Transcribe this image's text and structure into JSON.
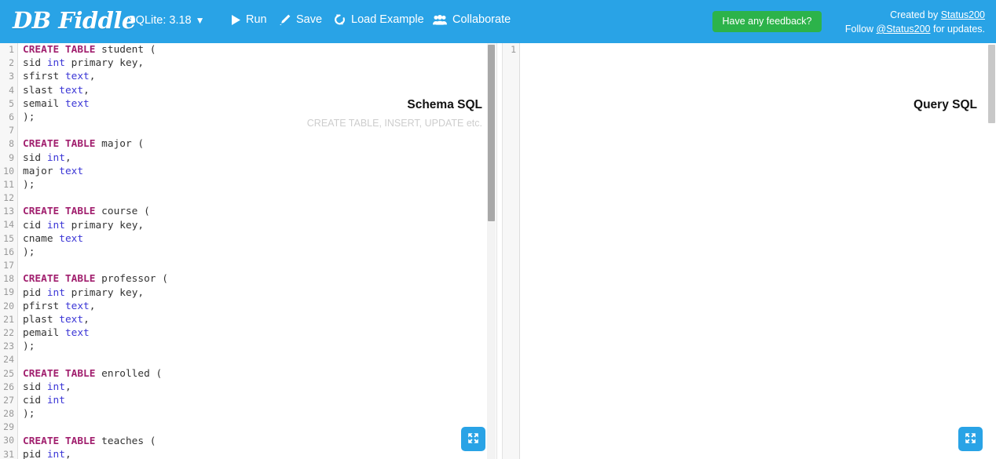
{
  "header": {
    "logo": "DB Fiddle",
    "db_version_label": "SQLite: 3.18",
    "db_caret": "▼",
    "buttons": [
      {
        "id": "run",
        "label": "Run",
        "icon": "play-icon"
      },
      {
        "id": "save",
        "label": "Save",
        "icon": "pencil-icon"
      },
      {
        "id": "load",
        "label": "Load Example",
        "icon": "refresh-icon"
      },
      {
        "id": "collaborate",
        "label": "Collaborate",
        "icon": "users-icon"
      }
    ],
    "feedback_label": "Have any feedback?",
    "credits_line1_prefix": "Created by ",
    "credits_line1_link": "Status200",
    "credits_line2_prefix": "Follow ",
    "credits_line2_link": "@Status200",
    "credits_line2_suffix": " for updates.",
    "colors": {
      "header_bg": "#29a3e6",
      "feedback_bg": "#2cb34a",
      "accent": "#29a3e6"
    }
  },
  "schema_panel": {
    "title": "Schema SQL",
    "hint": "CREATE TABLE, INSERT, UPDATE etc.",
    "expand_icon": "expand-arrows-icon",
    "first_line_number": 1,
    "line_count": 31,
    "lines": [
      [
        [
          "kw",
          "CREATE TABLE"
        ],
        [
          "ident",
          " student ("
        ]
      ],
      [
        [
          "ident",
          "sid "
        ],
        [
          "type",
          "int"
        ],
        [
          "ident",
          " primary key,"
        ]
      ],
      [
        [
          "ident",
          "sfirst "
        ],
        [
          "type",
          "text"
        ],
        [
          "ident",
          ","
        ]
      ],
      [
        [
          "ident",
          "slast "
        ],
        [
          "type",
          "text"
        ],
        [
          "ident",
          ","
        ]
      ],
      [
        [
          "ident",
          "semail "
        ],
        [
          "type",
          "text"
        ]
      ],
      [
        [
          "ident",
          ");"
        ]
      ],
      [
        [
          "ident",
          ""
        ]
      ],
      [
        [
          "kw",
          "CREATE TABLE"
        ],
        [
          "ident",
          " major ("
        ]
      ],
      [
        [
          "ident",
          "sid "
        ],
        [
          "type",
          "int"
        ],
        [
          "ident",
          ","
        ]
      ],
      [
        [
          "ident",
          "major "
        ],
        [
          "type",
          "text"
        ]
      ],
      [
        [
          "ident",
          ");"
        ]
      ],
      [
        [
          "ident",
          ""
        ]
      ],
      [
        [
          "kw",
          "CREATE TABLE"
        ],
        [
          "ident",
          " course ("
        ]
      ],
      [
        [
          "ident",
          "cid "
        ],
        [
          "type",
          "int"
        ],
        [
          "ident",
          " primary key,"
        ]
      ],
      [
        [
          "ident",
          "cname "
        ],
        [
          "type",
          "text"
        ]
      ],
      [
        [
          "ident",
          ");"
        ]
      ],
      [
        [
          "ident",
          ""
        ]
      ],
      [
        [
          "kw",
          "CREATE TABLE"
        ],
        [
          "ident",
          " professor ("
        ]
      ],
      [
        [
          "ident",
          "pid "
        ],
        [
          "type",
          "int"
        ],
        [
          "ident",
          " primary key,"
        ]
      ],
      [
        [
          "ident",
          "pfirst "
        ],
        [
          "type",
          "text"
        ],
        [
          "ident",
          ","
        ]
      ],
      [
        [
          "ident",
          "plast "
        ],
        [
          "type",
          "text"
        ],
        [
          "ident",
          ","
        ]
      ],
      [
        [
          "ident",
          "pemail "
        ],
        [
          "type",
          "text"
        ]
      ],
      [
        [
          "ident",
          ");"
        ]
      ],
      [
        [
          "ident",
          ""
        ]
      ],
      [
        [
          "kw",
          "CREATE TABLE"
        ],
        [
          "ident",
          " enrolled ("
        ]
      ],
      [
        [
          "ident",
          "sid "
        ],
        [
          "type",
          "int"
        ],
        [
          "ident",
          ","
        ]
      ],
      [
        [
          "ident",
          "cid "
        ],
        [
          "type",
          "int"
        ]
      ],
      [
        [
          "ident",
          ");"
        ]
      ],
      [
        [
          "ident",
          ""
        ]
      ],
      [
        [
          "kw",
          "CREATE TABLE"
        ],
        [
          "ident",
          " teaches ("
        ]
      ],
      [
        [
          "ident",
          "pid "
        ],
        [
          "type",
          "int"
        ],
        [
          "ident",
          ","
        ]
      ]
    ]
  },
  "query_panel": {
    "title": "Query SQL",
    "expand_icon": "expand-arrows-icon",
    "first_line_number": 1,
    "line_count": 1,
    "lines": [
      [
        [
          "ident",
          ""
        ]
      ]
    ]
  }
}
